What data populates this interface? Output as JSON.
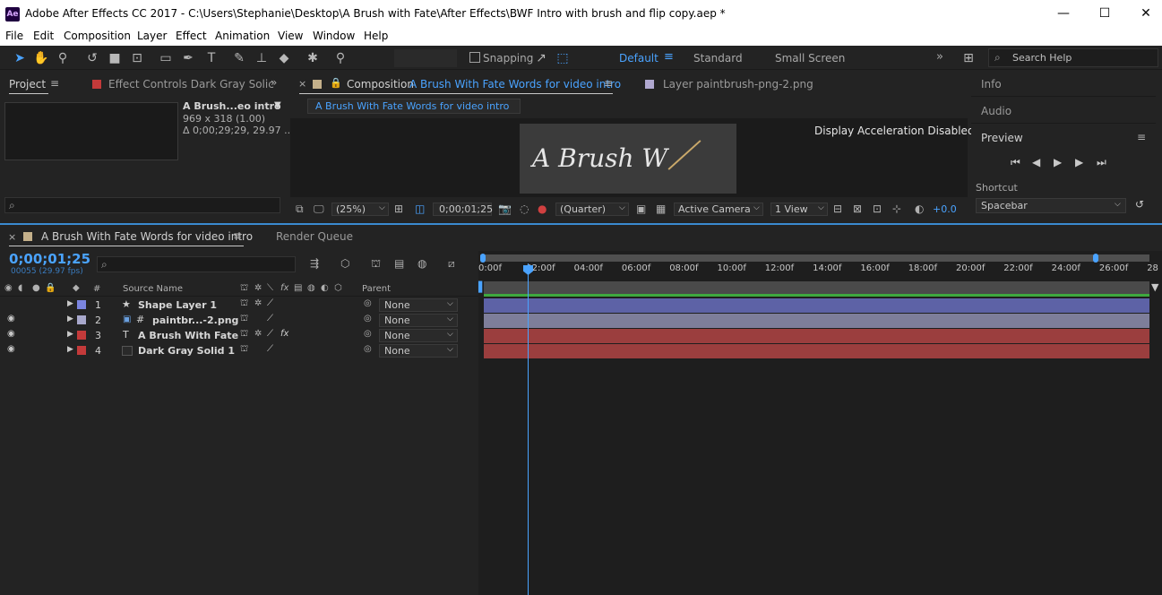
{
  "window": {
    "app_icon": "Ae",
    "title": "Adobe After Effects CC 2017 - C:\\Users\\Stephanie\\Desktop\\A Brush with Fate\\After Effects\\BWF Intro with brush and flip copy.aep *",
    "minimize": "—",
    "maximize": "☐",
    "close": "✕"
  },
  "menu": [
    "File",
    "Edit",
    "Composition",
    "Layer",
    "Effect",
    "Animation",
    "View",
    "Window",
    "Help"
  ],
  "toolbar": {
    "snapping_label": "Snapping",
    "workspaces": [
      "Default",
      "Standard",
      "Small Screen"
    ],
    "active_workspace": "Default",
    "search_placeholder": "Search Help"
  },
  "project_panel": {
    "tab": "Project",
    "effect_controls_tab": "Effect Controls Dark Gray Solic",
    "item_name": "A Brush...eo intro",
    "item_dims": "969 x 318 (1.00)",
    "item_duration": "Δ 0;00;29;29, 29.97 ..."
  },
  "composition_panel": {
    "tab_prefix": "Composition",
    "comp_name": "A Brush With Fate Words for video intro",
    "layer_tab": "Layer paintbrush-png-2.png",
    "breadcrumb": "A Brush With Fate Words for video intro",
    "notice": "Display Acceleration Disabled",
    "preview_text": "A Brush W",
    "zoom": "(25%)",
    "timecode": "0;00;01;25",
    "resolution": "(Quarter)",
    "camera": "Active Camera",
    "views": "1 View",
    "exposure": "+0.0"
  },
  "right_panels": {
    "info": "Info",
    "audio": "Audio",
    "preview": "Preview",
    "shortcut_label": "Shortcut",
    "shortcut_value": "Spacebar"
  },
  "timeline": {
    "tab": "A Brush With Fate Words for video intro",
    "render_queue": "Render Queue",
    "current_time": "0;00;01;25",
    "frame_info": "00055 (29.97 fps)",
    "col_number": "#",
    "col_source": "Source Name",
    "col_parent": "Parent",
    "ruler": [
      "0:00f",
      "02:00f",
      "04:00f",
      "06:00f",
      "08:00f",
      "10:00f",
      "12:00f",
      "14:00f",
      "16:00f",
      "18:00f",
      "20:00f",
      "22:00f",
      "24:00f",
      "26:00f",
      "28"
    ],
    "layers": [
      {
        "num": "1",
        "type_icon": "★",
        "name": "Shape Layer 1",
        "label_color": "#7b85e0",
        "parent": "None",
        "bar_color": "#5d62a6"
      },
      {
        "num": "2",
        "type_icon": "#",
        "name": "paintbr...-2.png",
        "label_color": "#a8a8cc",
        "parent": "None",
        "bar_color": "#7e7e9a"
      },
      {
        "num": "3",
        "type_icon": "T",
        "name": "A Brush With Fate",
        "label_color": "#c43a3a",
        "parent": "None",
        "bar_color": "#9b3e3e"
      },
      {
        "num": "4",
        "type_icon": "",
        "name": "Dark Gray Solid 1",
        "label_color": "#c43a3a",
        "parent": "None",
        "bar_color": "#9b3e3e"
      }
    ]
  },
  "colors": {
    "accent": "#4aa3ff",
    "panel_bg": "#232323",
    "work_area_green": "#3ea83e"
  }
}
